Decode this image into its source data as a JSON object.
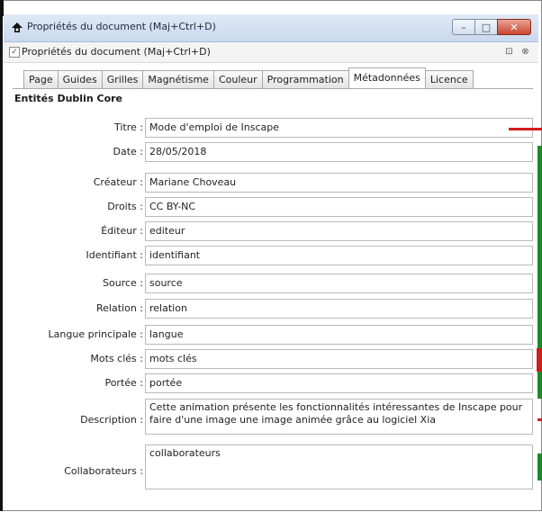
{
  "window": {
    "title": "Propriétés du document (Maj+Ctrl+D)",
    "controls": {
      "minimize": "–",
      "maximize": "□",
      "close": "✕"
    },
    "icon": "inkscape-logo-icon"
  },
  "dock": {
    "title": "Propriétés du document (Maj+Ctrl+D)",
    "check": "✓",
    "buttons": {
      "restore": "⊡",
      "close": "⊗"
    }
  },
  "tabs": [
    "Page",
    "Guides",
    "Grilles",
    "Magnétisme",
    "Couleur",
    "Programmation",
    "Métadonnées",
    "Licence"
  ],
  "active_tab": "Métadonnées",
  "section_title": "Entités Dublin Core",
  "fields": [
    {
      "label": "Titre :",
      "value": "Mode d'emploi de Inscape"
    },
    {
      "label": "Date :",
      "value": "28/05/2018"
    },
    {
      "label": "Créateur :",
      "value": "Mariane Choveau"
    },
    {
      "label": "Droits :",
      "value": "CC BY-NC"
    },
    {
      "label": "Éditeur :",
      "value": "editeur"
    },
    {
      "label": "Identifiant :",
      "value": "identifiant"
    },
    {
      "label": "Source :",
      "value": "source"
    },
    {
      "label": "Relation :",
      "value": "relation"
    },
    {
      "label": "Langue principale :",
      "value": "langue"
    },
    {
      "label": "Mots clés :",
      "value": "mots clés"
    },
    {
      "label": "Portée :",
      "value": "portée"
    },
    {
      "label": "Description :",
      "value": "Cette animation présente les fonctionnalités intéressantes de Inscape pour faire d'une image une image animée grâce au logiciel Xia"
    },
    {
      "label": "Collaborateurs :",
      "value": "collaborateurs"
    }
  ],
  "colors": {
    "accent_green": "#1a8a2a",
    "accent_red": "#d21d1d",
    "titlebar": "#c9d9ee"
  }
}
